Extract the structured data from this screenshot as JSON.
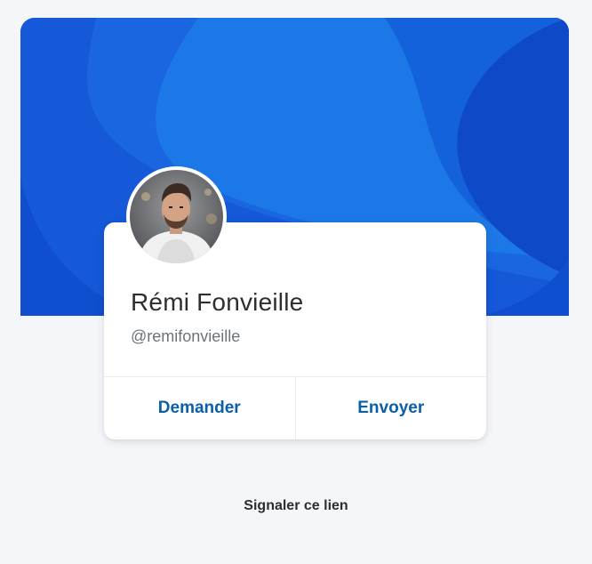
{
  "colors": {
    "hero_primary": "#1a66e0",
    "hero_dark": "#0f4fcf",
    "hero_light": "#1f7be8",
    "action_text": "#0a5fa8",
    "background": "#f5f6fa"
  },
  "profile": {
    "name": "Rémi Fonvieille",
    "handle": "@remifonvieille",
    "avatar_icon": "profile-photo"
  },
  "actions": {
    "request_label": "Demander",
    "send_label": "Envoyer"
  },
  "footer": {
    "report_label": "Signaler ce lien"
  }
}
